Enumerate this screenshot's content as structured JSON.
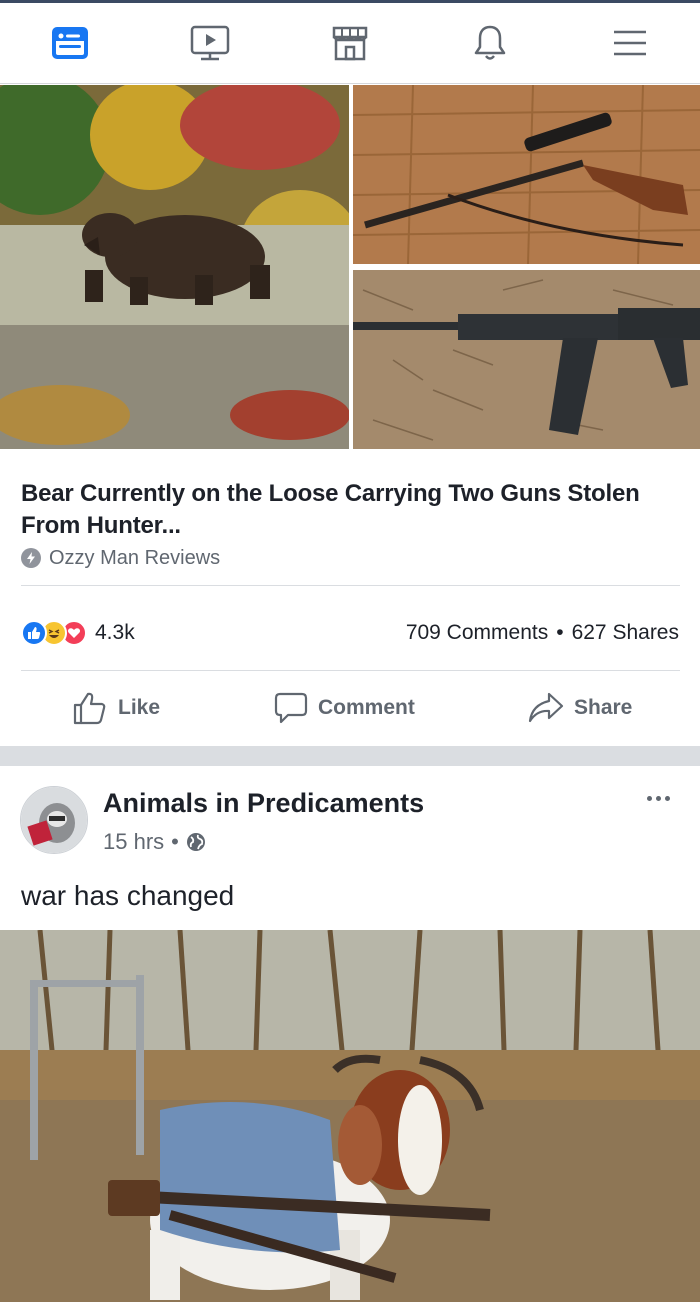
{
  "nav": {
    "items": [
      {
        "name": "news-feed",
        "active": true
      },
      {
        "name": "watch",
        "active": false
      },
      {
        "name": "marketplace",
        "active": false
      },
      {
        "name": "notifications",
        "active": false
      },
      {
        "name": "menu",
        "active": false
      }
    ],
    "active_color": "#1877f2",
    "inactive_color": "#606770"
  },
  "link_post": {
    "title_line1": "Bear Currently on the Loose Carrying Two Guns Stolen",
    "title_line2": "From Hunter...",
    "source": "Ozzy Man Reviews",
    "reactions": {
      "count": "4.3k",
      "types": [
        "like",
        "haha",
        "love"
      ]
    },
    "comments": "709 Comments",
    "separator": "•",
    "shares": "627 Shares",
    "images": [
      {
        "name": "bear-photo",
        "subject": "brown bear walking on tundra"
      },
      {
        "name": "rifle-photo",
        "subject": "scoped rifle on wooden floor"
      },
      {
        "name": "shotgun-photo",
        "subject": "black semi-automatic shotgun on pine needles"
      }
    ]
  },
  "actions": {
    "like": "Like",
    "comment": "Comment",
    "share": "Share"
  },
  "second_post": {
    "page_name": "Animals in Predicaments",
    "time": "15 hrs",
    "separator": "•",
    "privacy_icon": "globe-icon",
    "text": "war has changed",
    "photo": {
      "name": "goat-photo",
      "subject": "goat wearing blue vest with rifles strapped to it"
    }
  }
}
